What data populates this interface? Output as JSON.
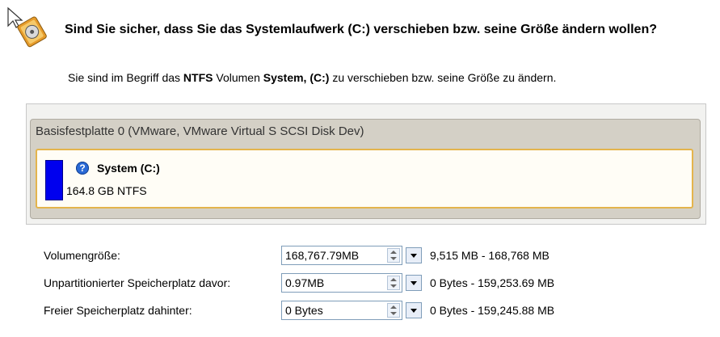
{
  "header": {
    "title": "Sind Sie sicher, dass Sie das Systemlaufwerk (C:) verschieben bzw. seine Größe ändern wollen?",
    "sub_pre": "Sie sind im Begriff das ",
    "sub_fs": "NTFS",
    "sub_mid": " Volumen ",
    "sub_vol": "System, (C:)",
    "sub_post": " zu verschieben bzw. seine Größe zu ändern."
  },
  "disk": {
    "title": "Basisfestplatte 0 (VMware, VMware Virtual S SCSI Disk Dev)",
    "partition": {
      "name": "System (C:)",
      "size": "164.8 GB NTFS",
      "usage_color": "#0000ee"
    }
  },
  "fields": [
    {
      "label": "Volumengröße:",
      "value": "168,767.79MB",
      "range": "9,515 MB - 168,768 MB"
    },
    {
      "label": "Unpartitionierter Speicherplatz davor:",
      "value": "0.97MB",
      "range": "0 Bytes - 159,253.69 MB"
    },
    {
      "label": "Freier Speicherplatz dahinter:",
      "value": "0 Bytes",
      "range": "0 Bytes - 159,245.88 MB"
    }
  ],
  "colors": {
    "accent_border": "#e4b44c",
    "partition_fill": "#0000ee"
  }
}
